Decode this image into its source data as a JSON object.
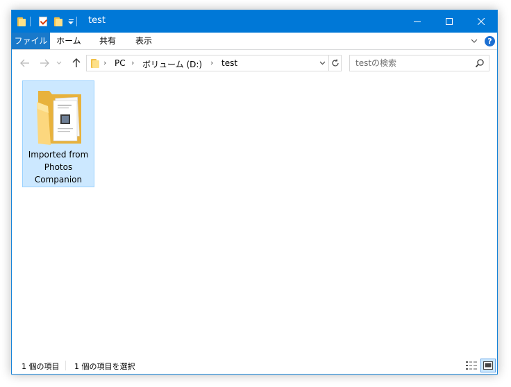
{
  "window": {
    "title": "test",
    "accent_color": "#0078d7",
    "title_controls": [
      "minimize-icon",
      "maximize-icon",
      "close-icon"
    ]
  },
  "ribbon": {
    "tabs": [
      {
        "label": "ファイル",
        "active": true
      },
      {
        "label": "ホーム"
      },
      {
        "label": "共有"
      },
      {
        "label": "表示"
      }
    ],
    "help_label": "?"
  },
  "nav": {
    "breadcrumb": [
      "PC",
      "ボリューム (D:)",
      "test"
    ],
    "search_placeholder": "testの検索"
  },
  "items": [
    {
      "name_lines": [
        "Imported from",
        "Photos",
        "Companion"
      ],
      "selected": true,
      "icon": "folder-with-documents-icon"
    }
  ],
  "status": {
    "item_count": "1 個の項目",
    "selected_count": "1 個の項目を選択"
  }
}
